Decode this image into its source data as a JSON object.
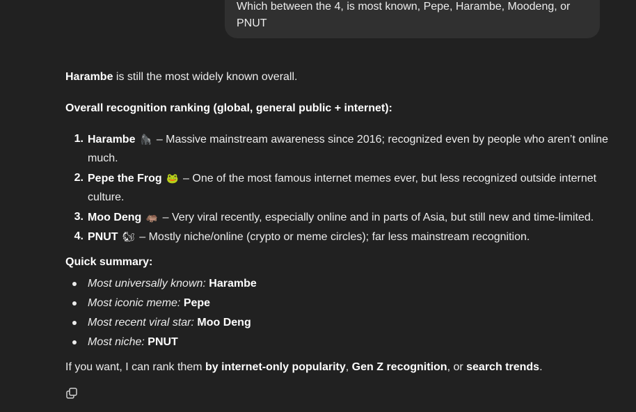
{
  "user_message": {
    "line1": "Which between the 4, is most known, Pepe, Harambe, Moodeng, or",
    "line2": "PNUT"
  },
  "response": {
    "intro_bold": "Harambe",
    "intro_rest": " is still the most widely known overall.",
    "ranking_heading": "Overall recognition ranking (global, general public + internet):",
    "ranking": [
      {
        "num": "1.",
        "name": "Harambe",
        "emoji": "🦍",
        "text_line1": " – Massive mainstream awareness since 2016; recognized even by people who aren’t online",
        "text_line2": "much."
      },
      {
        "num": "2.",
        "name": "Pepe the Frog",
        "emoji": "🐸",
        "text_line1": " – One of the most famous internet memes ever, but less recognized outside internet",
        "text_line2": "culture."
      },
      {
        "num": "3.",
        "name": "Moo Deng",
        "emoji": "🦛",
        "text_line1": " – Very viral recently, especially online and in parts of Asia, but still new and time-limited."
      },
      {
        "num": "4.",
        "name": "PNUT",
        "emoji": "🐿",
        "text_line1": " – Mostly niche/online (crypto or meme circles); far less mainstream recognition."
      }
    ],
    "summary_heading": "Quick summary:",
    "summary": [
      {
        "label": "Most universally known:",
        "value": "Harambe"
      },
      {
        "label": "Most iconic meme:",
        "value": "Pepe"
      },
      {
        "label": "Most recent viral star:",
        "value": "Moo Deng"
      },
      {
        "label": "Most niche:",
        "value": "PNUT"
      }
    ],
    "closing": {
      "part1": "If you want, I can rank them ",
      "bold1": "by internet-only popularity",
      "sep1": ", ",
      "bold2": "Gen Z recognition",
      "sep2": ", or ",
      "bold3": "search trends",
      "end": "."
    }
  },
  "actions": {
    "copy_icon": "copy-icon"
  },
  "colors": {
    "background": "#212121",
    "user_bubble": "#303030",
    "text": "#ececec"
  }
}
